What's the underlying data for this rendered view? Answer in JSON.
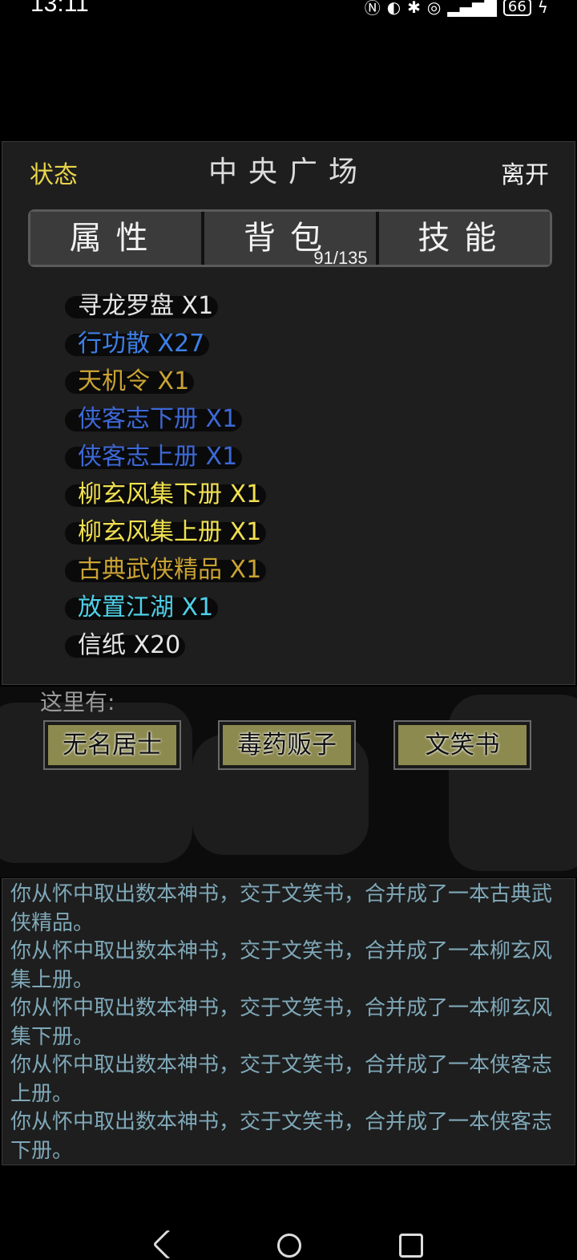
{
  "status_bar": {
    "time": "13:11",
    "battery": "66"
  },
  "header": {
    "status": "状态",
    "title": "中央广场",
    "leave": "离开"
  },
  "tabs": [
    {
      "label": "属性"
    },
    {
      "label": "背包",
      "count": "91/135"
    },
    {
      "label": "技能"
    }
  ],
  "inventory": [
    {
      "name": "寻龙罗盘 X1",
      "color": "#e6e6e6"
    },
    {
      "name": "行功散 X27",
      "color": "#3d7fe6"
    },
    {
      "name": "天机令 X1",
      "color": "#c9a233"
    },
    {
      "name": "侠客志下册 X1",
      "color": "#3d68d6"
    },
    {
      "name": "侠客志上册 X1",
      "color": "#3d68d6"
    },
    {
      "name": "柳玄风集下册 X1",
      "color": "#f0e050"
    },
    {
      "name": "柳玄风集上册 X1",
      "color": "#f0e050"
    },
    {
      "name": "古典武侠精品 X1",
      "color": "#c9a233"
    },
    {
      "name": "放置江湖 X1",
      "color": "#4fd0e8"
    },
    {
      "name": "信纸 X20",
      "color": "#e6e6e6"
    }
  ],
  "npcs": {
    "label": "这里有:",
    "list": [
      "无名居士",
      "毒药贩子",
      "文笑书"
    ]
  },
  "log": [
    "你从怀中取出数本神书，交于文笑书，合并成了一本古典武侠精品。",
    "你从怀中取出数本神书，交于文笑书，合并成了一本柳玄风集上册。",
    "你从怀中取出数本神书，交于文笑书，合并成了一本柳玄风集下册。",
    "你从怀中取出数本神书，交于文笑书，合并成了一本侠客志上册。",
    "你从怀中取出数本神书，交于文笑书，合并成了一本侠客志下册。"
  ]
}
